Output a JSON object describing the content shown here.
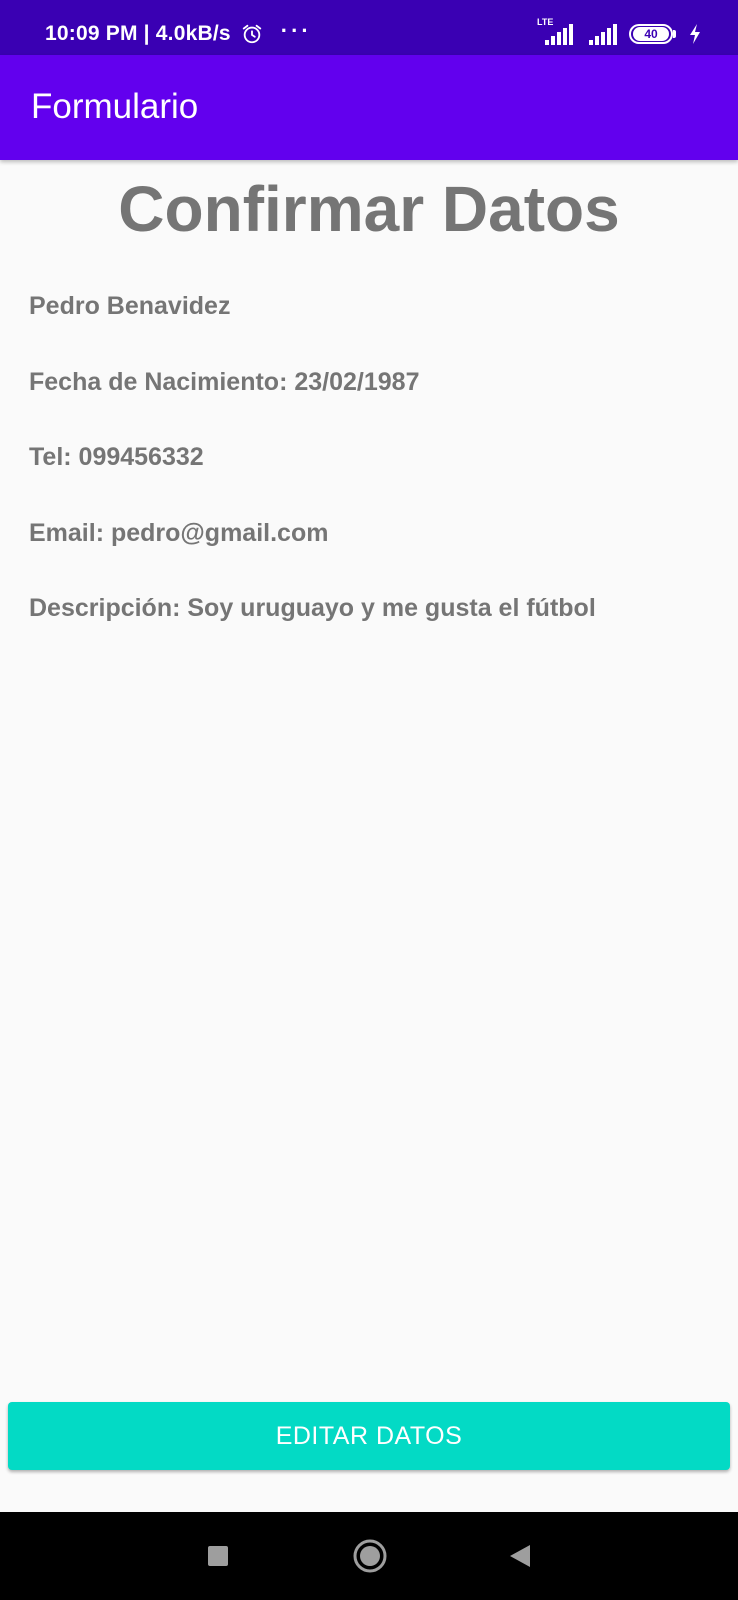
{
  "status_bar": {
    "time_speed": "10:09 PM | 4.0kB/s",
    "more": "···",
    "network_label": "LTE",
    "battery_level": "40"
  },
  "app_bar": {
    "title": "Formulario"
  },
  "main": {
    "heading": "Confirmar Datos",
    "name": "Pedro Benavidez",
    "birth_date": "Fecha de Nacimiento: 23/02/1987",
    "phone": "Tel: 099456332",
    "email": "Email: pedro@gmail.com",
    "description": "Descripción: Soy uruguayo y me gusta el fútbol",
    "edit_button_label": "EDITAR DATOS"
  },
  "nav_bar": {
    "icons": [
      "square-recents-icon",
      "circle-home-icon",
      "triangle-back-icon"
    ]
  },
  "colors": {
    "status_bar": "#3a00b3",
    "app_bar": "#6200ee",
    "button": "#03dac5",
    "text_gray": "#757575"
  }
}
